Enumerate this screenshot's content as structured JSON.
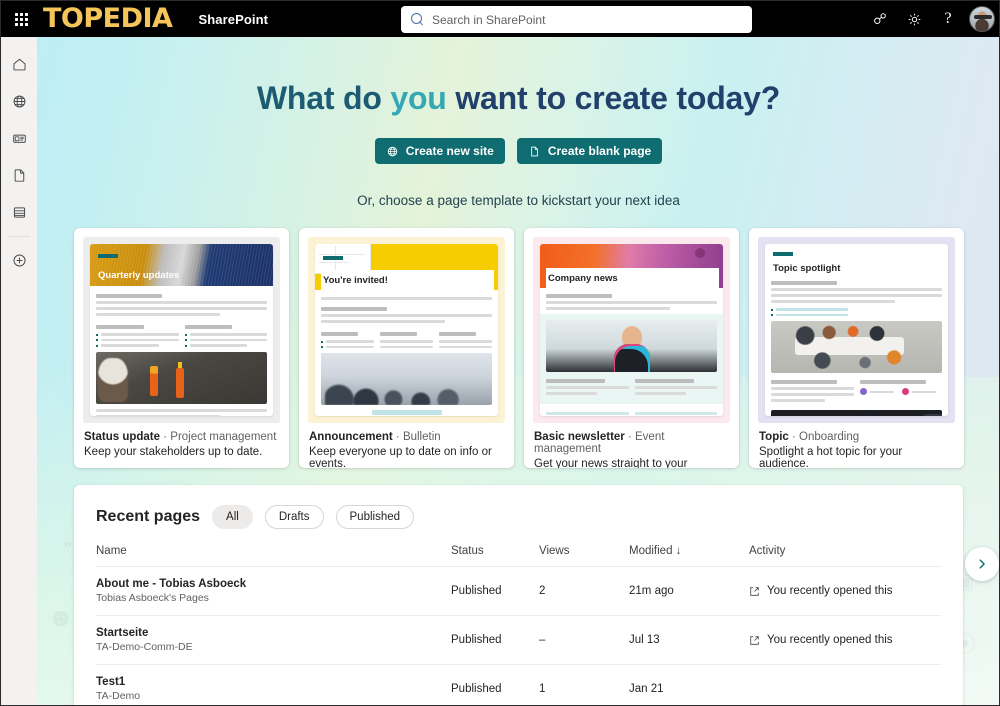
{
  "suite": {
    "waffle_label": "app-launcher",
    "logo": "TOPEDIA",
    "app_name": "SharePoint",
    "search_placeholder": "Search in SharePoint",
    "icons": [
      "meet-now-icon",
      "settings-gear-icon",
      "help-question-icon",
      "account-avatar"
    ]
  },
  "rail": {
    "items": [
      {
        "name": "home",
        "icon": "home-icon"
      },
      {
        "name": "sites",
        "icon": "globe-icon"
      },
      {
        "name": "news",
        "icon": "news-icon"
      },
      {
        "name": "pages",
        "icon": "page-icon"
      },
      {
        "name": "lists",
        "icon": "list-icon"
      },
      {
        "name": "create",
        "icon": "plus-circle-icon"
      }
    ]
  },
  "hero": {
    "heading_part1": "What do ",
    "heading_part2": "you",
    "heading_part3": " want to create today?",
    "create_site_label": "Create new site",
    "create_page_label": "Create blank page",
    "subheading": "Or, choose a page template to kickstart your next idea"
  },
  "templates": [
    {
      "preview_title": "Quarterly updates",
      "title": "Status update",
      "category": "Project management",
      "description": "Keep your stakeholders up to date."
    },
    {
      "preview_title": "You're invited!",
      "title": "Announcement",
      "category": "Bulletin",
      "description": "Keep everyone up to date on info or events."
    },
    {
      "preview_title": "Company news",
      "title": "Basic newsletter",
      "category": "Event management",
      "description": "Get your news straight to your readers."
    },
    {
      "preview_title": "Topic spotlight",
      "title": "Topic",
      "category": "Onboarding",
      "description": "Spotlight a hot topic for your audience."
    }
  ],
  "carousel": {
    "next_label": "next-templates"
  },
  "recent": {
    "title": "Recent pages",
    "filters": [
      {
        "label": "All",
        "active": true
      },
      {
        "label": "Drafts",
        "active": false
      },
      {
        "label": "Published",
        "active": false
      }
    ],
    "columns": {
      "name": "Name",
      "status": "Status",
      "views": "Views",
      "modified": "Modified",
      "sort_arrow": "↓",
      "activity": "Activity"
    },
    "rows": [
      {
        "name": "About me - Tobias Asboeck",
        "site": "Tobias Asboeck's Pages",
        "status": "Published",
        "views": "2",
        "modified": "21m ago",
        "activity": "You recently opened this"
      },
      {
        "name": "Startseite",
        "site": "TA-Demo-Comm-DE",
        "status": "Published",
        "views": "–",
        "modified": "Jul 13",
        "activity": "You recently opened this"
      },
      {
        "name": "Test1",
        "site": "TA-Demo",
        "status": "Published",
        "views": "1",
        "modified": "Jan 21",
        "activity": ""
      }
    ]
  },
  "colors": {
    "brand_yellow": "#F5C55A",
    "teal_button": "#0F6C70",
    "heading_dark": "#21406b",
    "heading_accent": "#34a9b5"
  }
}
